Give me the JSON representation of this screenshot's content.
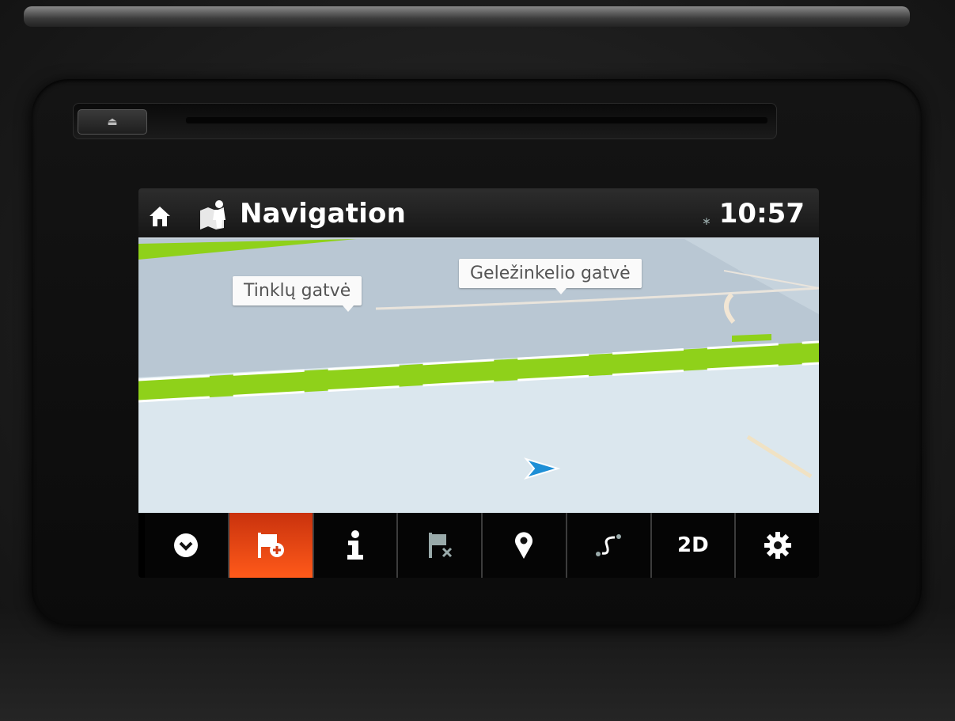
{
  "header": {
    "title": "Navigation",
    "clock": "10:57",
    "icons": [
      "home-icon",
      "map-person-icon",
      "bluetooth-icon"
    ]
  },
  "map": {
    "street_labels": [
      "Tinklų gatvė",
      "Geležinkelio gatvė"
    ],
    "route_color": "#8fd11a",
    "vehicle_marker_color": "#1e8fd6"
  },
  "toolbar": {
    "items": [
      {
        "icon": "chevron-down-icon"
      },
      {
        "icon": "flag-add-icon",
        "active": true
      },
      {
        "icon": "info-icon"
      },
      {
        "icon": "flag-cancel-icon"
      },
      {
        "icon": "location-pin-icon"
      },
      {
        "icon": "route-icon"
      },
      {
        "icon": "view-mode-icon",
        "label": "2D"
      },
      {
        "icon": "gear-icon"
      }
    ],
    "active_color": "#ff5a1a"
  }
}
